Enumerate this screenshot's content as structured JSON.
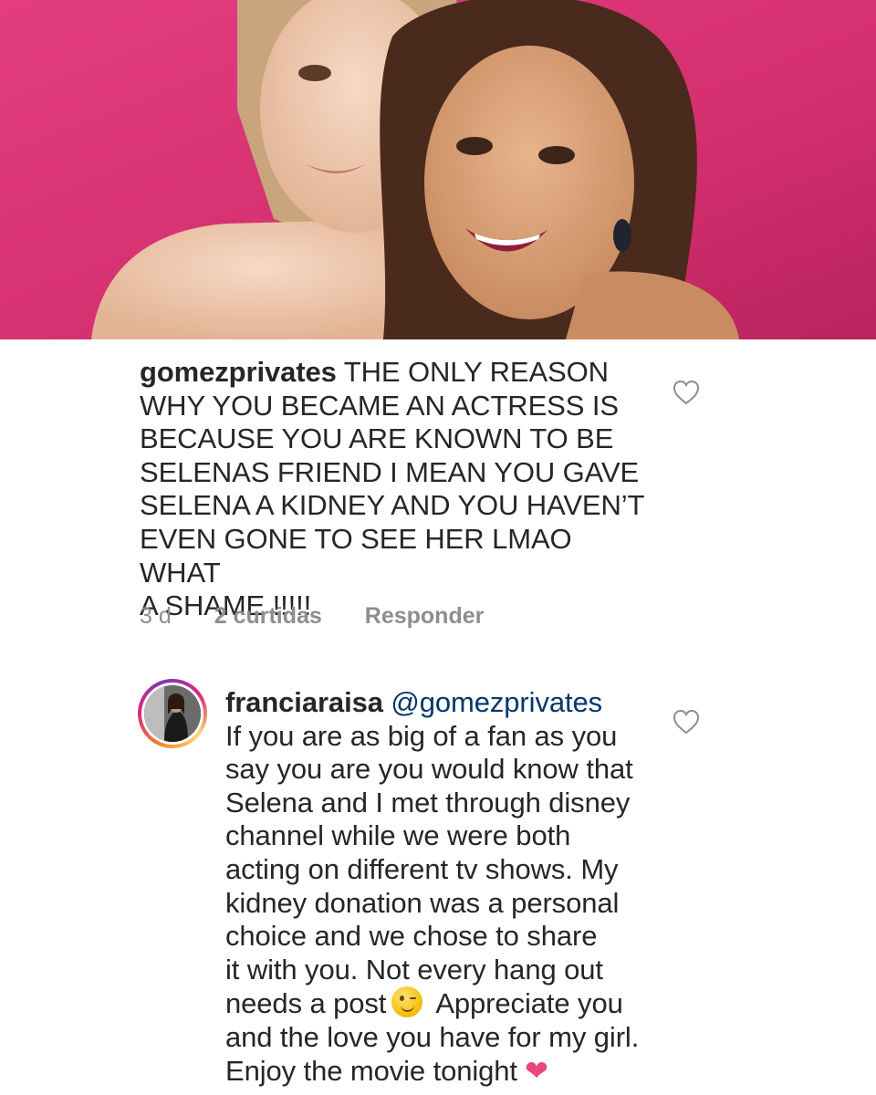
{
  "comments": [
    {
      "username": "gomezprivates",
      "lines": [
        " THE ONLY REASON",
        "WHY YOU BECAME AN ACTRESS IS",
        "BECAUSE YOU ARE KNOWN TO BE",
        "SELENAS FRIEND I MEAN YOU GAVE",
        "SELENA A KIDNEY AND YOU HAVEN’T",
        "EVEN GONE TO SEE HER LMAO WHAT",
        "A SHAME !!!!!"
      ],
      "time": "3 d",
      "likes": "2 curtidas",
      "reply_label": "Responder"
    },
    {
      "username": "franciaraisa",
      "mention": "@gomezprivates",
      "lines": [
        "If you are as big of a fan as you",
        "say you are you would know that",
        "Selena and I met through disney",
        "channel while we were both",
        "acting on different tv shows. My",
        "kidney donation was a personal",
        "choice and we chose to share",
        "it with you. Not every hang out"
      ],
      "line9_before_emoji": "needs a post",
      "line9_after_emoji": "Appreciate you",
      "line10": "and the love you have for my girl.",
      "line11": "Enjoy the movie tonight",
      "emoji_icons": [
        "winking-face-icon",
        "heart-icon"
      ]
    }
  ],
  "colors": {
    "photo_background": "#d6336f",
    "text": "#262626",
    "meta": "#8e8e8e",
    "mention": "#00376b",
    "heart_emoji": "#e8477a"
  },
  "icons": [
    "like-heart-icon",
    "avatar-story-ring"
  ]
}
